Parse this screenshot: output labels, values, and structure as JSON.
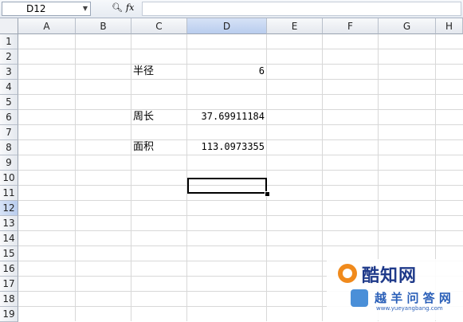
{
  "formula_bar": {
    "name_box": "D12",
    "zoom_icon": "magnifier-icon",
    "fx_label": "fx",
    "formula": ""
  },
  "columns": [
    "A",
    "B",
    "C",
    "D",
    "E",
    "F",
    "G",
    "H"
  ],
  "selected_column": "D",
  "rows": [
    "1",
    "2",
    "3",
    "4",
    "5",
    "6",
    "7",
    "8",
    "9",
    "10",
    "11",
    "12",
    "13",
    "14",
    "15",
    "16",
    "17",
    "18",
    "19"
  ],
  "selected_row": "12",
  "cells": {
    "C3": "半径",
    "D3": "6",
    "C6": "周长",
    "D6": "37.69911184",
    "C8": "面积",
    "D8": "113.0973355"
  },
  "selected_cell": "D12",
  "watermark": {
    "title": "酷知网",
    "subtitle": "越 羊 问 答 网",
    "url": "www.yueyangbang.com"
  }
}
